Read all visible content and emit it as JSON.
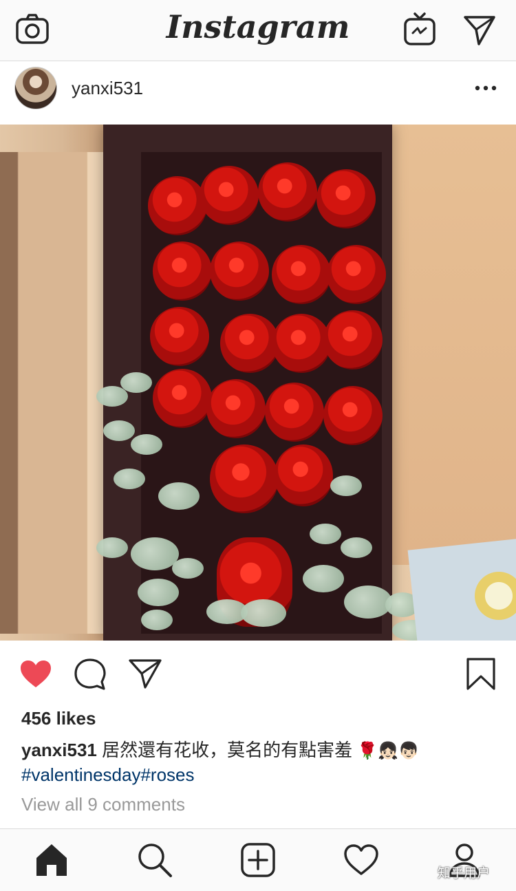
{
  "app": {
    "logo_text": "Instagram"
  },
  "post": {
    "username": "yanxi531",
    "likes_text": "456 likes",
    "caption_username": "yanxi531",
    "caption_text": " 居然還有花收，莫名的有點害羞",
    "caption_emojis": "🌹👧🏻👦🏻",
    "hashtags": "#valentinesday#roses",
    "view_comments": "View all 9 comments"
  },
  "icons": {
    "top": [
      "camera-icon",
      "igtv-icon",
      "direct-send-icon"
    ],
    "post_header": [
      "more-options-icon"
    ],
    "actions": [
      "like-heart-icon",
      "comment-icon",
      "share-icon",
      "save-bookmark-icon"
    ],
    "nav": [
      "home-icon",
      "search-icon",
      "add-post-icon",
      "activity-heart-icon",
      "profile-icon"
    ]
  },
  "colors": {
    "like_active": "#ed4956",
    "hashtag": "#003569",
    "muted_text": "#999999",
    "bar_bg": "#fafafa"
  },
  "watermark": {
    "text": "知乎用户"
  }
}
